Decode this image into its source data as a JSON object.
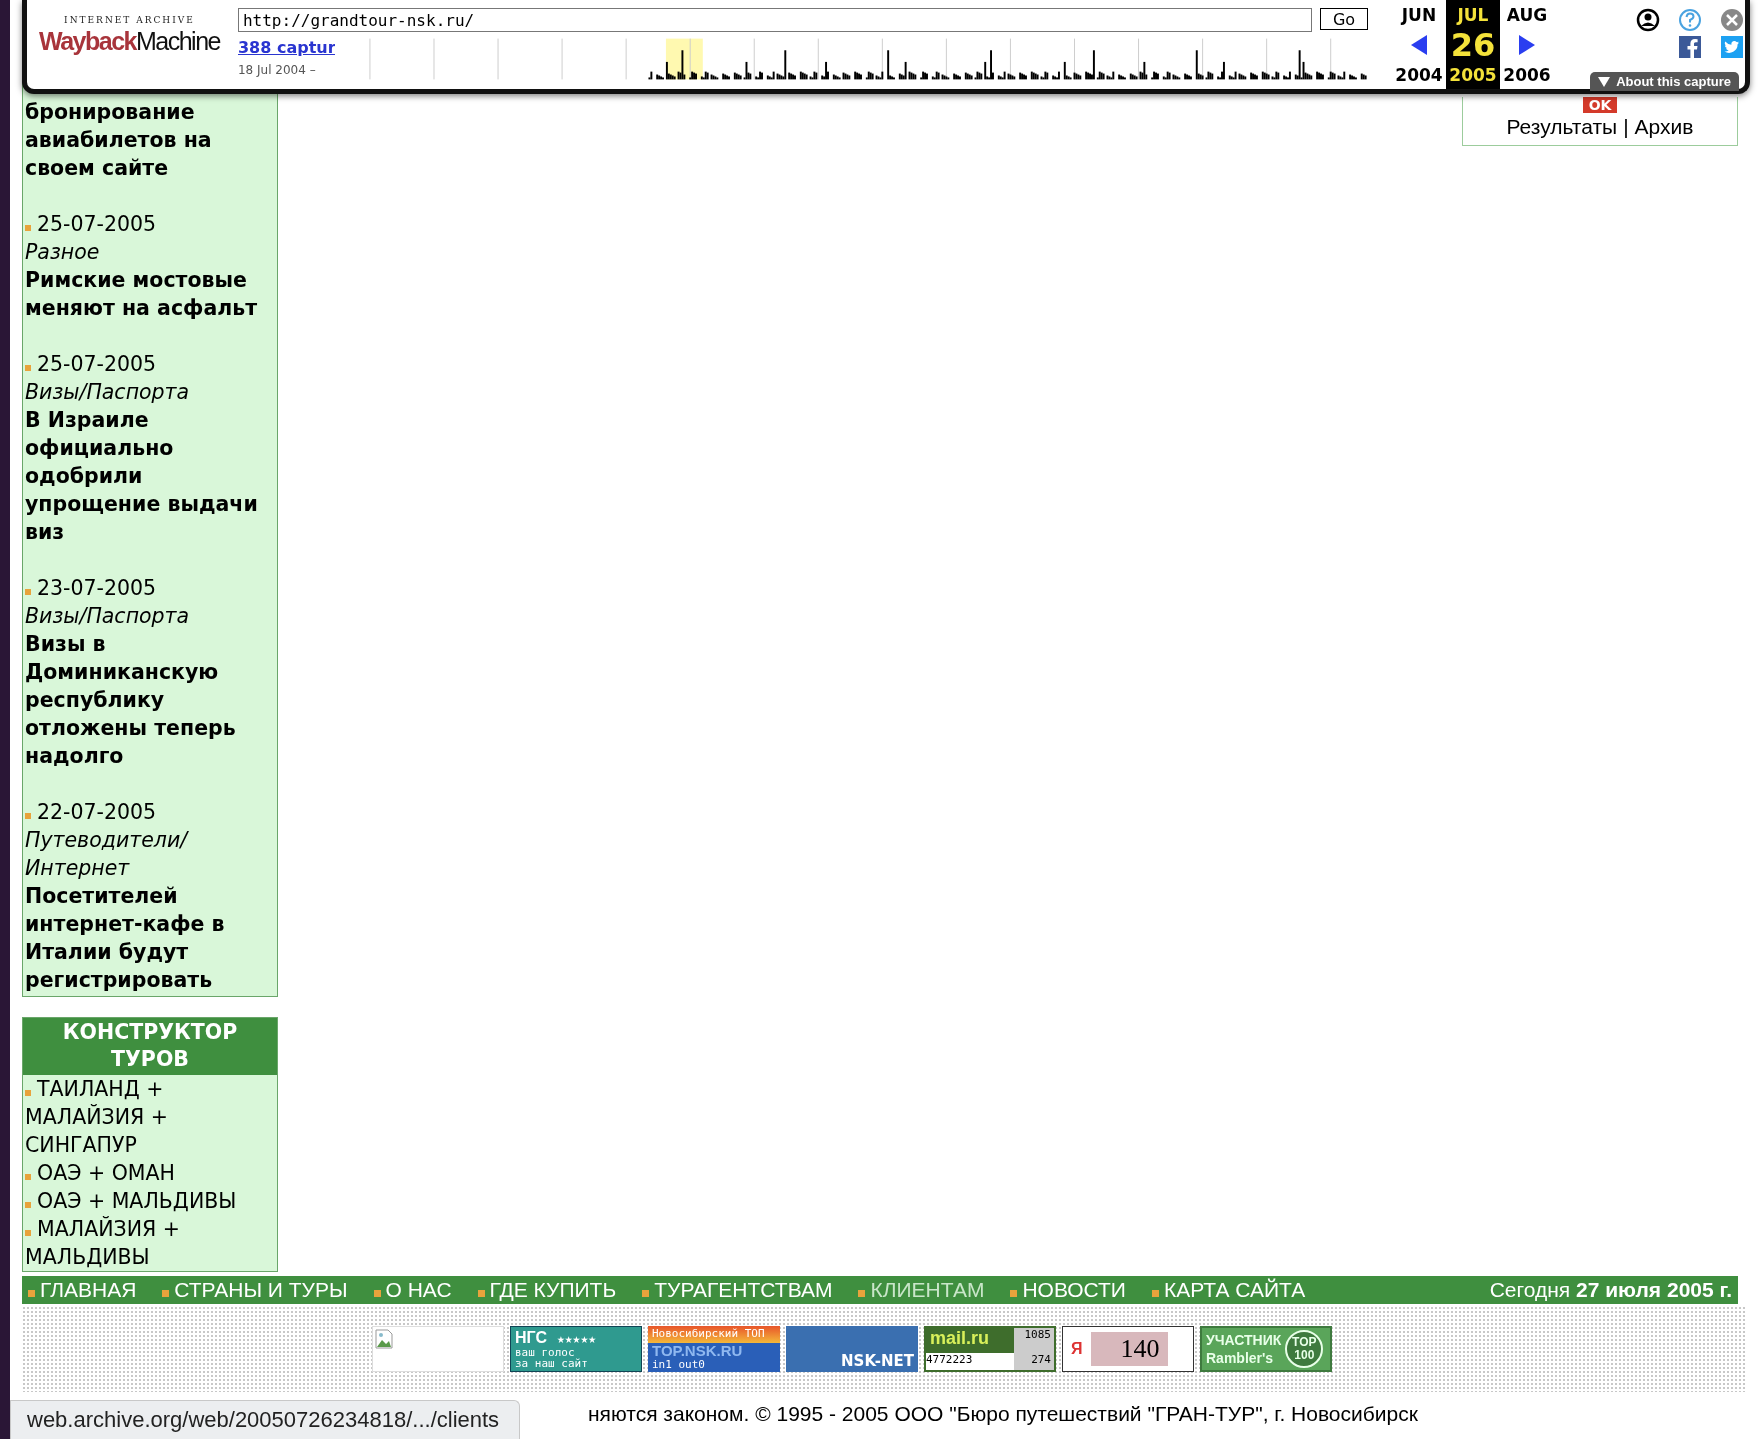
{
  "wayback": {
    "logo_top": "INTERNET ARCHIVE",
    "logo_words": [
      "Wayback",
      "Machine"
    ],
    "url": "http://grandtour-nsk.ru/",
    "go_label": "Go",
    "captures_link": "388 captur",
    "date_range": "18 Jul 2004 –",
    "months": [
      {
        "label": "JUN",
        "selected": false
      },
      {
        "label": "JUL",
        "selected": true
      },
      {
        "label": "AUG",
        "selected": false
      }
    ],
    "day": "26",
    "years": [
      {
        "label": "2004",
        "selected": false
      },
      {
        "label": "2005",
        "selected": true
      },
      {
        "label": "2006",
        "selected": false
      }
    ],
    "about_label": "About this capture"
  },
  "news": {
    "intro": "бронирование авиабилетов на своем сайте",
    "items": [
      {
        "date": "25-07-2005",
        "category": "Разное",
        "title": "Римские мостовые меняют на асфальт"
      },
      {
        "date": "25-07-2005",
        "category": "Визы/Паспорта",
        "title": "В Израиле официально одобрили упрощение выдачи виз"
      },
      {
        "date": "23-07-2005",
        "category": "Визы/Паспорта",
        "title": "Визы в Доминиканскую республику отложены теперь надолго"
      },
      {
        "date": "22-07-2005",
        "category": "Путеводители/ Интернет",
        "title": "Посетителей интернет-кафе в Италии будут регистрировать"
      }
    ]
  },
  "tour_builder": {
    "title": "КОНСТРУКТОР ТУРОВ",
    "items": [
      "ТАИЛАНД + МАЛАЙЗИЯ + СИНГАПУР",
      "ОАЭ + ОМАН",
      "ОАЭ + МАЛЬДИВЫ",
      "МАЛАЙЗИЯ + МАЛЬДИВЫ"
    ]
  },
  "search_widget": {
    "badge": "OK",
    "links": [
      "Результаты",
      "Архив"
    ],
    "separator": "|"
  },
  "nav": {
    "items": [
      {
        "label": "ГЛАВНАЯ",
        "selected": false
      },
      {
        "label": "СТРАНЫ И ТУРЫ",
        "selected": false
      },
      {
        "label": "О НАС",
        "selected": false
      },
      {
        "label": "ГДЕ КУПИТЬ",
        "selected": false
      },
      {
        "label": "ТУРАГЕНТСТВАМ",
        "selected": false
      },
      {
        "label": "КЛИЕНТАМ",
        "selected": true
      },
      {
        "label": "НОВОСТИ",
        "selected": false
      },
      {
        "label": "КАРТА САЙТА",
        "selected": false
      }
    ],
    "today": "Сегодня **27 июля 2005 г.**"
  },
  "banners": [
    {
      "kind": "broken-image"
    },
    {
      "kind": "ngs",
      "texts": [
        "НГС",
        "★★★★★",
        "ваш голос",
        "за наш сайт"
      ]
    },
    {
      "kind": "nsk-top",
      "texts": [
        "Новосибирский ТОП",
        "TOP.NSK.RU",
        "in1 out0"
      ]
    },
    {
      "kind": "nsk-net",
      "texts": [
        "NSK-NET"
      ]
    },
    {
      "kind": "mailru",
      "texts": [
        "mail.ru",
        "1085",
        "4772223",
        "274"
      ]
    },
    {
      "kind": "yandex",
      "texts": [
        "Я",
        "140"
      ]
    },
    {
      "kind": "rambler",
      "texts": [
        "УЧАСТНИК",
        "Rambler's",
        "TOP",
        "100"
      ]
    }
  ],
  "footer": {
    "copyright": "няются законом. © 1995 - 2005 ООО \"Бюро путешествий \"ГРАН-ТУР\", г. Новосибирск"
  },
  "status_bar": {
    "url": "web.archive.org/web/20050726234818/.../clients"
  }
}
